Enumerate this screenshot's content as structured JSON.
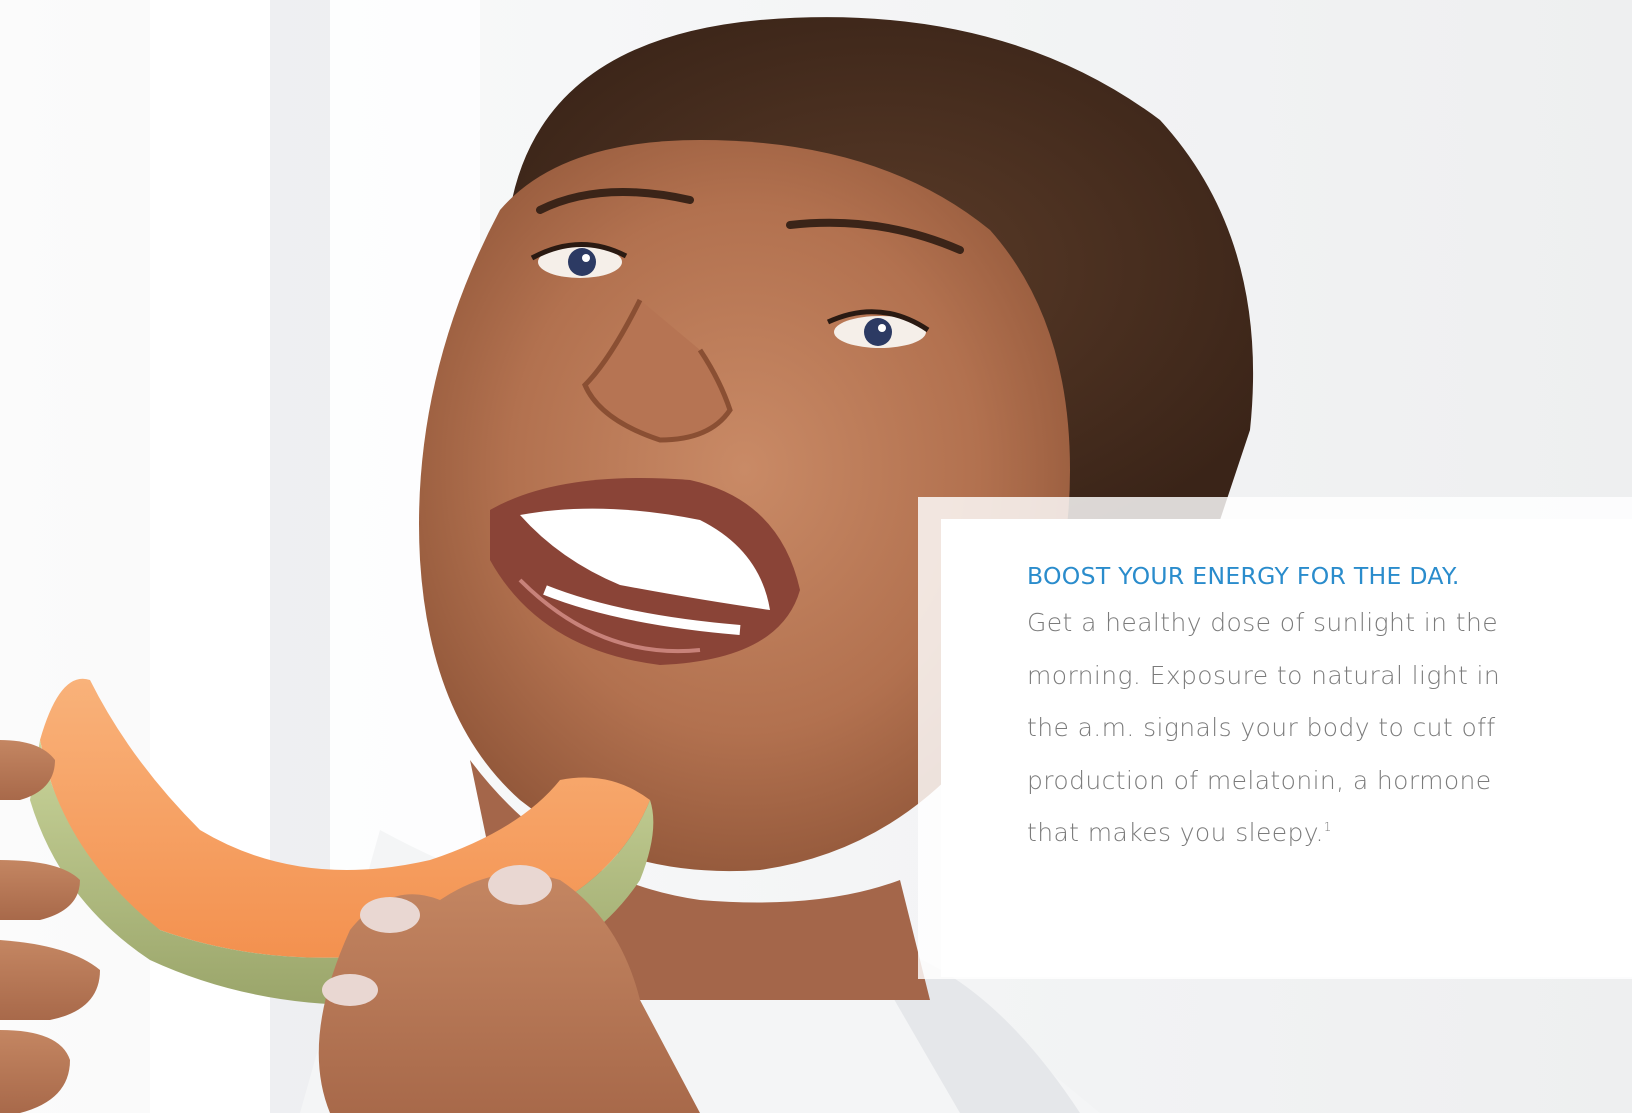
{
  "photo": {
    "subject": "smiling-woman-eating-cantaloupe-photo"
  },
  "card": {
    "heading": "BOOST YOUR ENERGY FOR THE DAY.",
    "body": "Get a healthy dose of sunlight in the morning. Exposure to natural light in the a.m. signals your body to cut off production of melatonin, a hormone that makes you sleepy.",
    "footnote": "1",
    "heading_color": "#2a8ccc",
    "body_color": "#7b7b7b"
  }
}
